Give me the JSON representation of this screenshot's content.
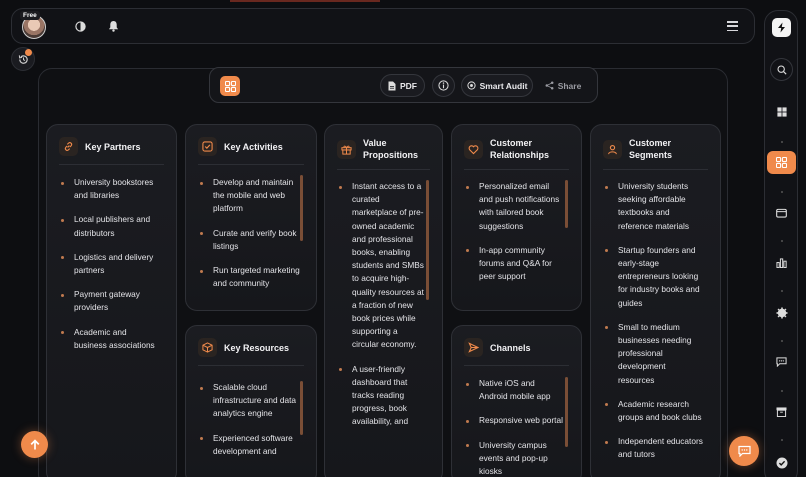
{
  "header": {
    "plan_badge": "Free",
    "icons": [
      "avatar",
      "contrast-icon",
      "bell-icon",
      "menu-icon"
    ]
  },
  "toolbar": {
    "pdf_label": "PDF",
    "audit_label": "Smart Audit",
    "share_label": "Share"
  },
  "cards": {
    "key_partners": {
      "title": "Key Partners",
      "items": [
        "University bookstores and libraries",
        "Local publishers and distributors",
        "Logistics and delivery partners",
        "Payment gateway providers",
        "Academic and business associations"
      ]
    },
    "key_activities": {
      "title": "Key Activities",
      "items": [
        "Develop and maintain the mobile and web platform",
        "Curate and verify book listings",
        "Run targeted marketing and community"
      ]
    },
    "key_resources": {
      "title": "Key Resources",
      "items": [
        "Scalable cloud infrastructure and data analytics engine",
        "Experienced software development and"
      ]
    },
    "value_propositions": {
      "title": "Value Propositions",
      "items": [
        "Instant access to a curated marketplace of pre-owned academic and professional books, enabling students and SMBs to acquire high-quality resources at a fraction of new book prices while supporting a circular economy.",
        "A user-friendly dashboard that tracks reading progress, book availability, and"
      ]
    },
    "customer_relationships": {
      "title": "Customer Relationships",
      "items": [
        "Personalized email and push notifications with tailored book suggestions",
        "In-app community forums and Q&A for peer support"
      ]
    },
    "channels": {
      "title": "Channels",
      "items": [
        "Native iOS and Android mobile app",
        "Responsive web portal",
        "University campus events and pop-up kiosks"
      ]
    },
    "customer_segments": {
      "title": "Customer Segments",
      "items": [
        "University students seeking affordable textbooks and reference materials",
        "Startup founders and early-stage entrepreneurs looking for industry books and guides",
        "Small to medium businesses needing professional development resources",
        "Academic research groups and book clubs",
        "Independent educators and tutors"
      ]
    }
  },
  "colors": {
    "accent": "#f08a4b",
    "background": "#0d0e11",
    "card": "#1b1c21"
  }
}
